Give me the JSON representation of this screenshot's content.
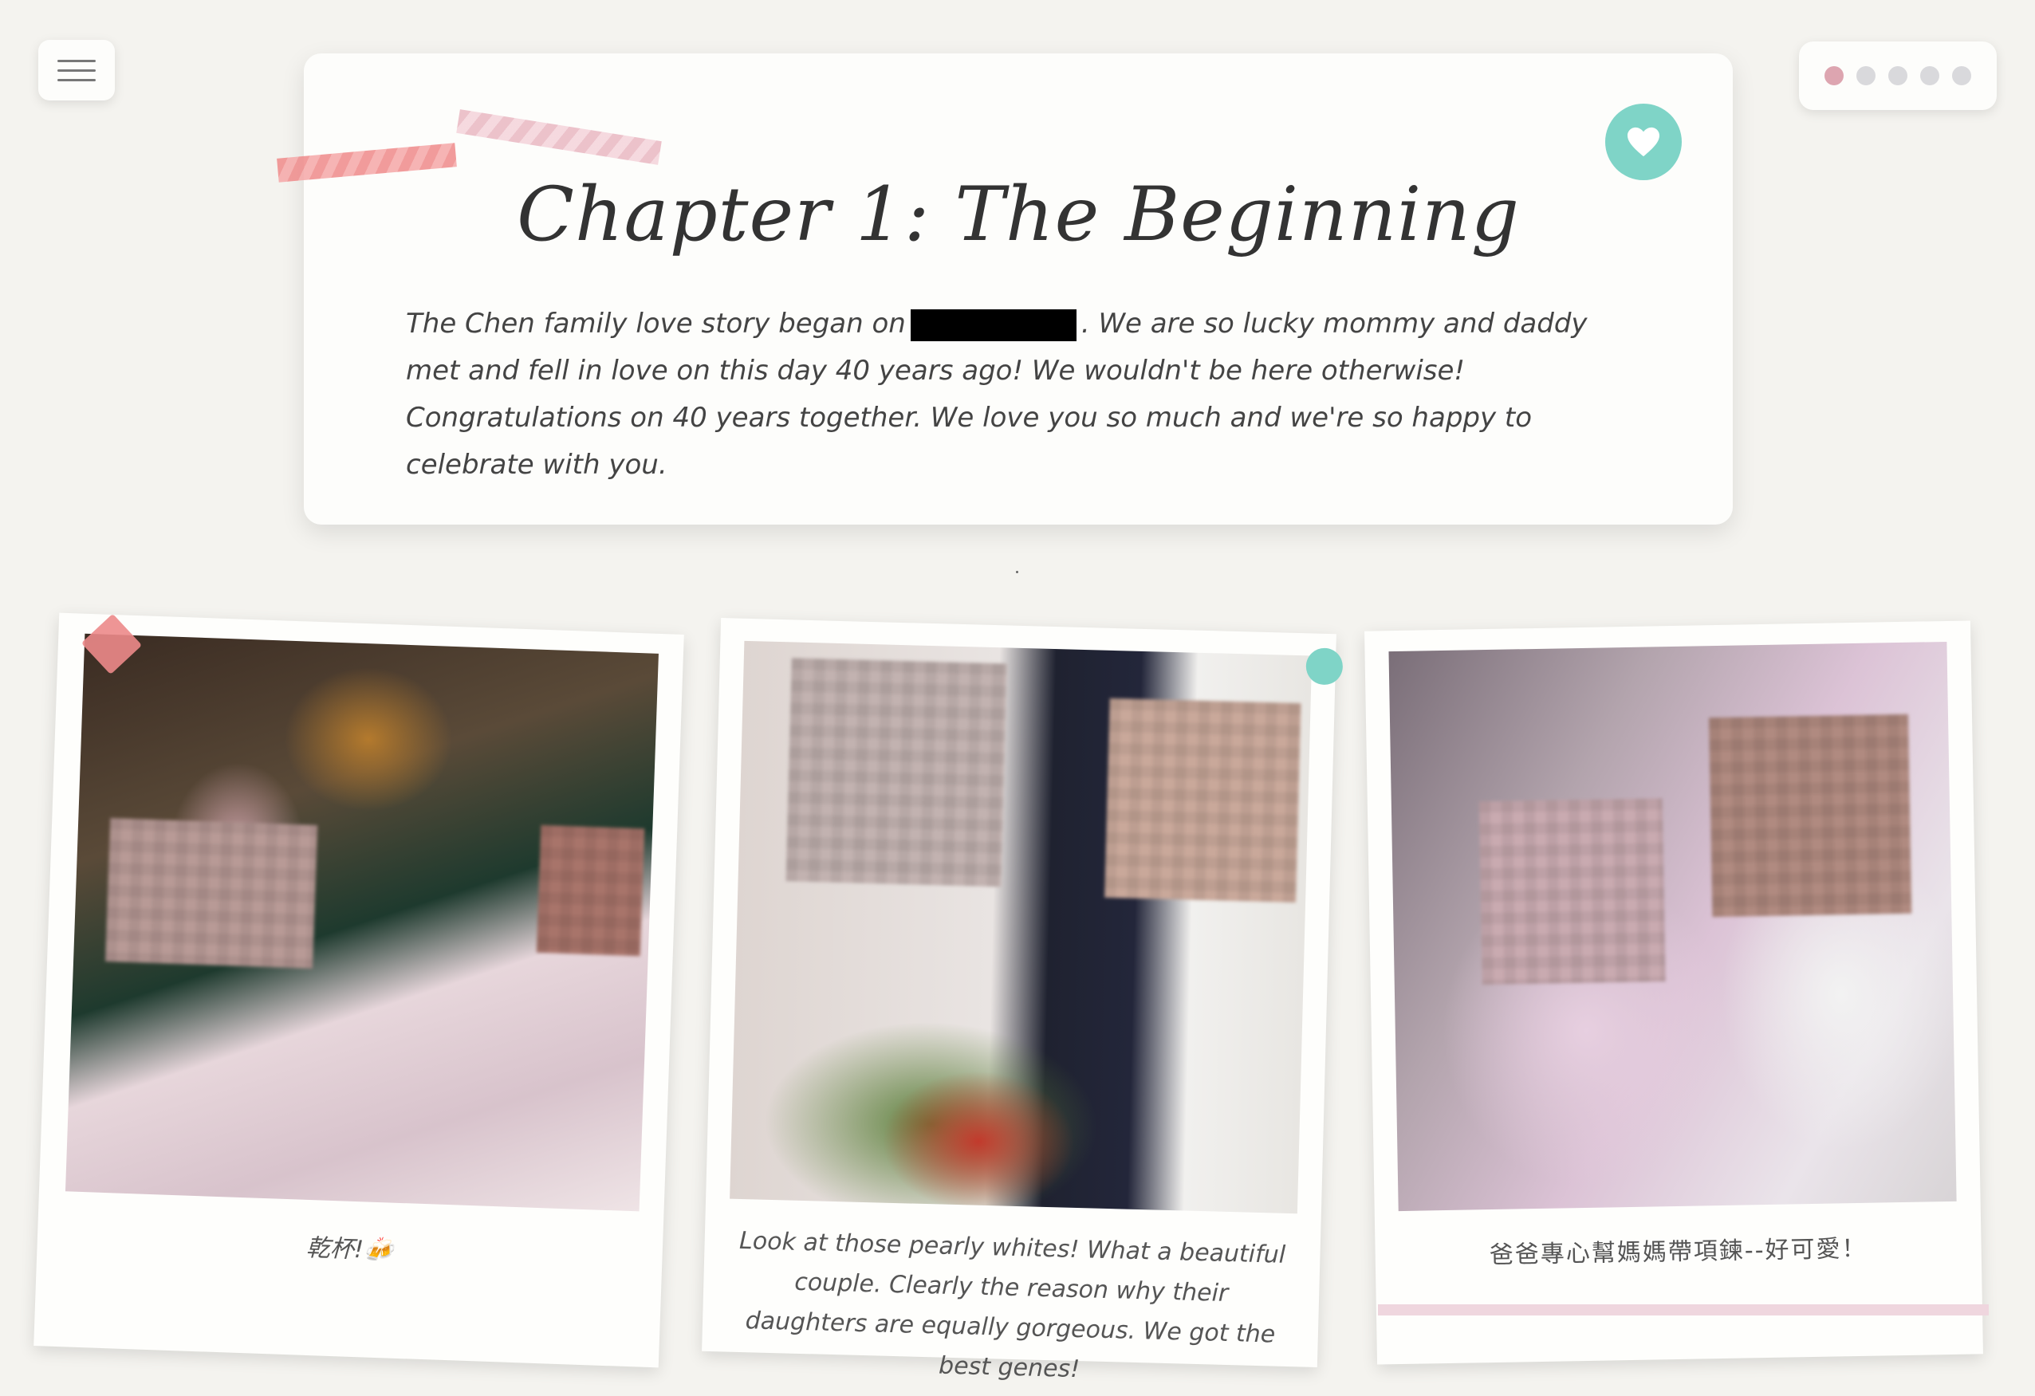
{
  "chapter": {
    "title": "Chapter 1: The Beginning",
    "text_before": "The Chen family love story began on",
    "text_after": ". We are so lucky mommy and daddy met and fell in love on this day 40 years ago! We wouldn't be here otherwise! Congratulations on 40 years together. We love you so much and we're so happy to celebrate with you."
  },
  "photos": [
    {
      "caption": "乾杯!🍻"
    },
    {
      "caption": "Look at those pearly whites! What a beautiful couple. Clearly the reason why their daughters are equally gorgeous. We got the best genes!"
    },
    {
      "caption": "爸爸專心幫媽媽帶項鍊--好可愛！"
    }
  ],
  "navigation": {
    "slide_count": 5,
    "active_index": 0
  },
  "colors": {
    "accent_teal": "#7fd4c7",
    "accent_pink": "#dda5b0",
    "tape_red": "#ef8a8a",
    "background": "#f4f3ef"
  },
  "icons": {
    "menu": "hamburger-menu-icon",
    "badge": "heart-icon"
  }
}
